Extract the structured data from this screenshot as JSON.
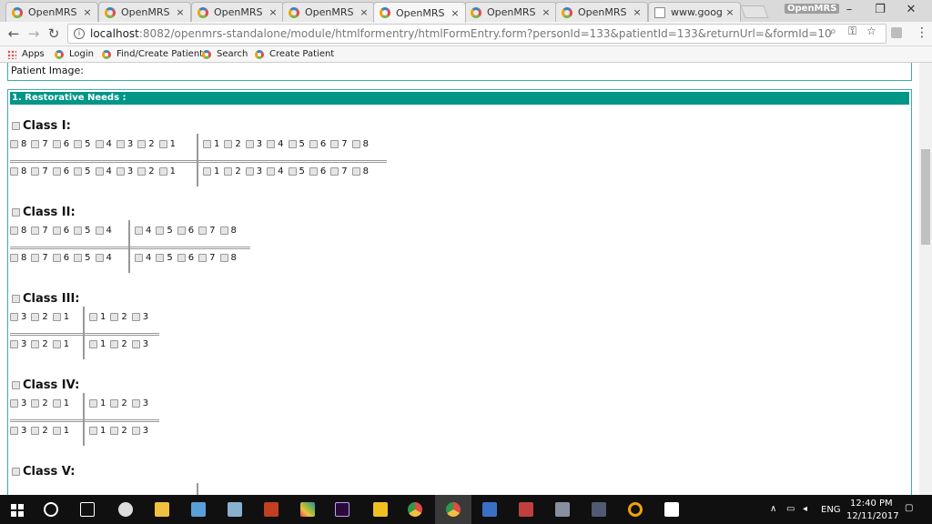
{
  "tabs": [
    {
      "title": "OpenMRS E",
      "icon": "openmrs-icon",
      "active": false
    },
    {
      "title": "OpenMRS",
      "icon": "openmrs-icon",
      "active": false
    },
    {
      "title": "OpenMRS",
      "icon": "openmrs-icon",
      "active": false
    },
    {
      "title": "OpenMRS E",
      "icon": "openmrs-icon",
      "active": false
    },
    {
      "title": "OpenMRS",
      "icon": "openmrs-icon",
      "active": true
    },
    {
      "title": "OpenMRS",
      "icon": "openmrs-icon",
      "active": false
    },
    {
      "title": "OpenMRS -",
      "icon": "openmrs-icon",
      "active": false
    },
    {
      "title": "www.googl",
      "icon": "doc-icon",
      "active": false
    }
  ],
  "profile_label": "OpenMRS",
  "address": {
    "host": "localhost",
    "path": ":8082/openmrs-standalone/module/htmlformentry/htmlFormEntry.form?personId=133&patientId=133&returnUrl=&formId=10"
  },
  "bookmarks": {
    "apps": "Apps",
    "login": "Login",
    "find_create": "Find/Create Patient",
    "search": "Search",
    "create": "Create Patient"
  },
  "page": {
    "patient_image_label": "Patient Image:",
    "section_title": "1. Restorative Needs :",
    "classes": [
      {
        "title": "Class I:",
        "left": [
          "8",
          "7",
          "6",
          "5",
          "4",
          "3",
          "2",
          "1"
        ],
        "right": [
          "1",
          "2",
          "3",
          "4",
          "5",
          "6",
          "7",
          "8"
        ]
      },
      {
        "title": "Class II:",
        "left": [
          "8",
          "7",
          "6",
          "5",
          "4"
        ],
        "right": [
          "4",
          "5",
          "6",
          "7",
          "8"
        ]
      },
      {
        "title": "Class III:",
        "left": [
          "3",
          "2",
          "1"
        ],
        "right": [
          "1",
          "2",
          "3"
        ]
      },
      {
        "title": "Class IV:",
        "left": [
          "3",
          "2",
          "1"
        ],
        "right": [
          "1",
          "2",
          "3"
        ]
      },
      {
        "title": "Class V:",
        "left": [],
        "right": []
      }
    ]
  },
  "taskbar": {
    "language": "ENG",
    "time": "12:40 PM",
    "date": "12/11/2017"
  },
  "colors": {
    "section_header": "#009688",
    "form_border": "#3ab0a6"
  }
}
